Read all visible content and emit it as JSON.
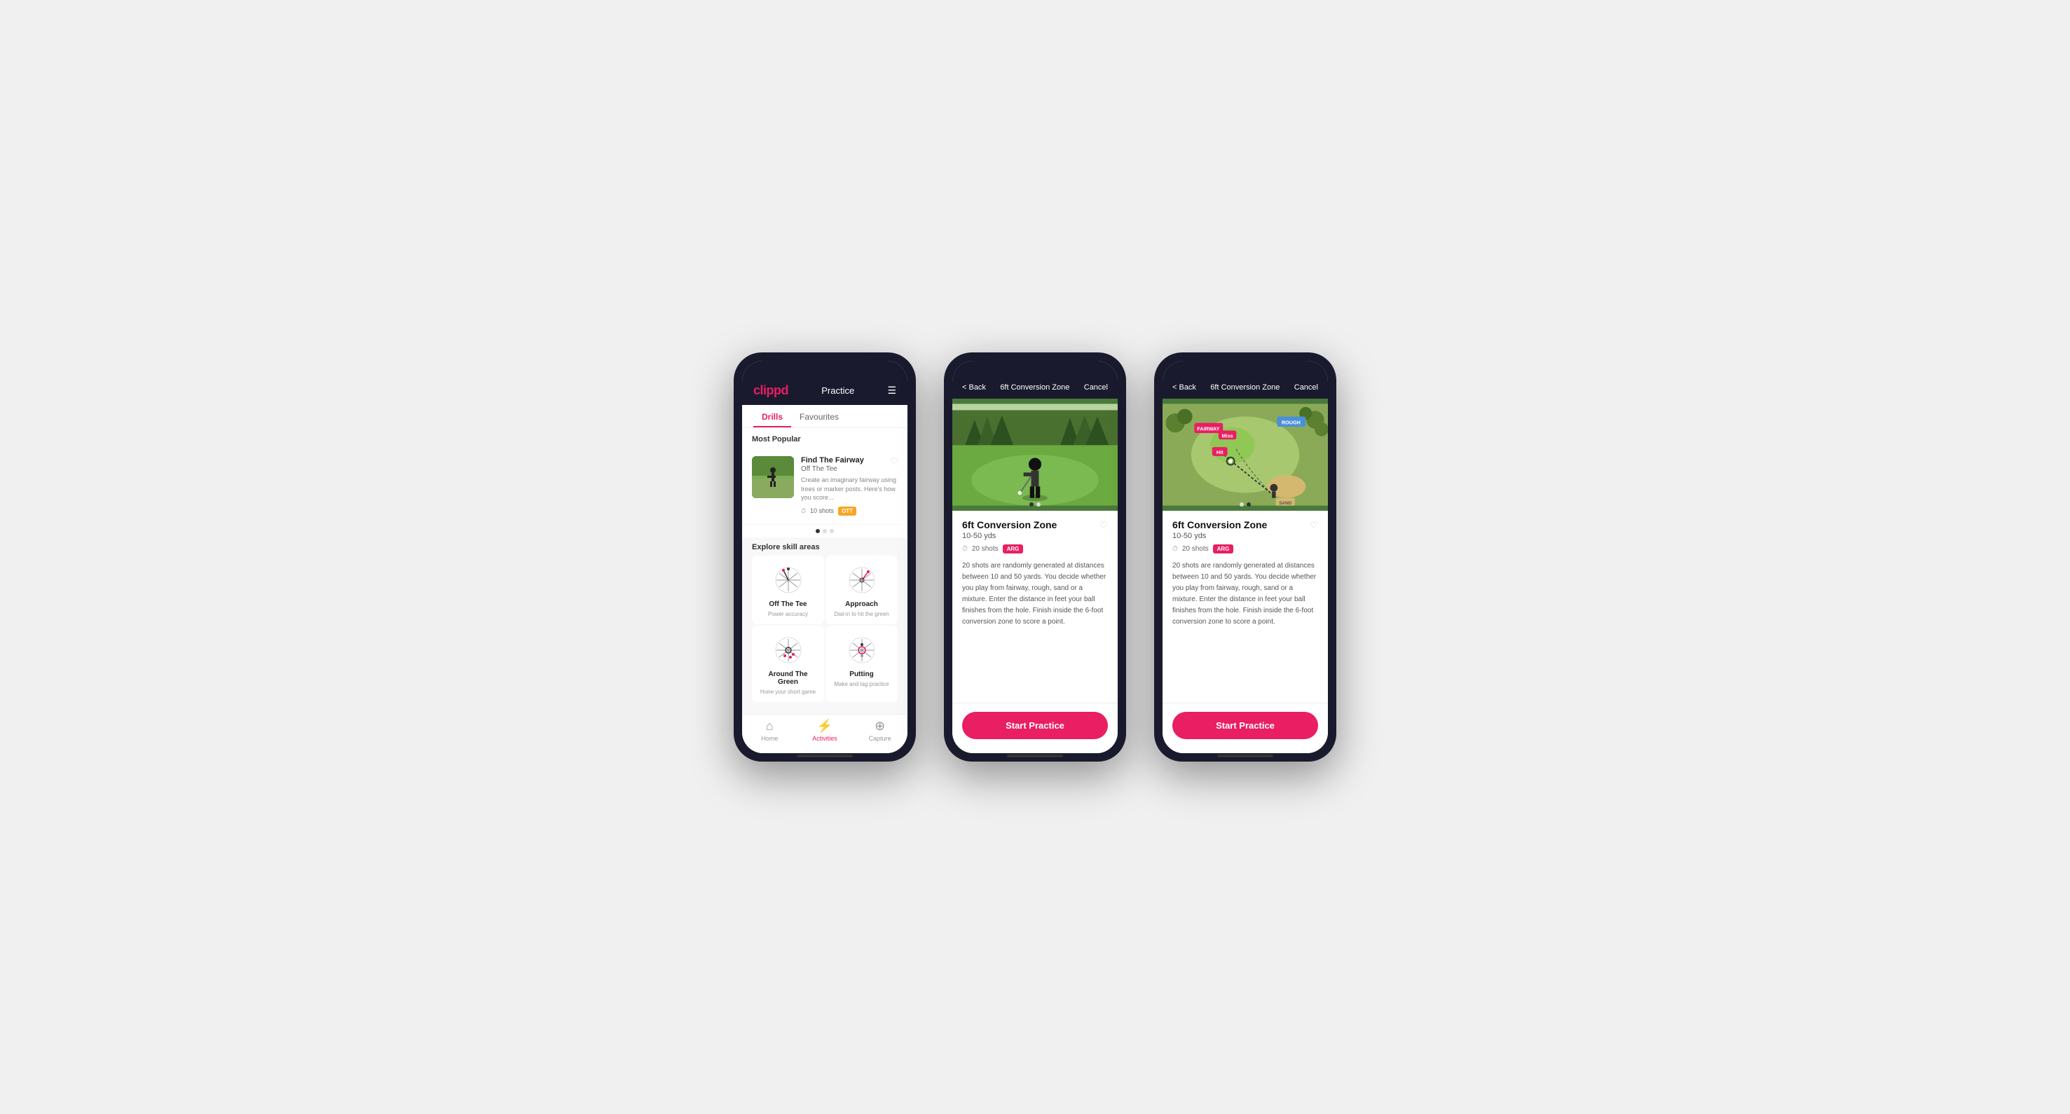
{
  "phone1": {
    "logo": "clippd",
    "header_title": "Practice",
    "tabs": [
      "Drills",
      "Favourites"
    ],
    "active_tab": 0,
    "most_popular": "Most Popular",
    "card": {
      "title": "Find The Fairway",
      "subtitle": "Off The Tee",
      "description": "Create an imaginary fairway using trees or marker posts. Here's how you score...",
      "shots": "10 shots",
      "badge": "OTT"
    },
    "explore_title": "Explore skill areas",
    "skills": [
      {
        "name": "Off The Tee",
        "desc": "Power accuracy"
      },
      {
        "name": "Approach",
        "desc": "Dial-in to hit the green"
      },
      {
        "name": "Around The Green",
        "desc": "Hone your short game"
      },
      {
        "name": "Putting",
        "desc": "Make and lag practice"
      }
    ],
    "nav": [
      {
        "icon": "🏠",
        "label": "Home",
        "active": false
      },
      {
        "icon": "⚡",
        "label": "Activities",
        "active": true
      },
      {
        "icon": "➕",
        "label": "Capture",
        "active": false
      }
    ]
  },
  "phone2": {
    "back_label": "< Back",
    "title": "6ft Conversion Zone",
    "cancel_label": "Cancel",
    "drill_title": "6ft Conversion Zone",
    "drill_range": "10-50 yds",
    "shots": "20 shots",
    "badge": "ARG",
    "description": "20 shots are randomly generated at distances between 10 and 50 yards. You decide whether you play from fairway, rough, sand or a mixture. Enter the distance in feet your ball finishes from the hole. Finish inside the 6-foot conversion zone to score a point.",
    "start_label": "Start Practice",
    "dots": [
      true,
      false
    ]
  },
  "phone3": {
    "back_label": "< Back",
    "title": "6ft Conversion Zone",
    "cancel_label": "Cancel",
    "drill_title": "6ft Conversion Zone",
    "drill_range": "10-50 yds",
    "shots": "20 shots",
    "badge": "ARG",
    "description": "20 shots are randomly generated at distances between 10 and 50 yards. You decide whether you play from fairway, rough, sand or a mixture. Enter the distance in feet your ball finishes from the hole. Finish inside the 6-foot conversion zone to score a point.",
    "start_label": "Start Practice",
    "dots": [
      false,
      true
    ]
  }
}
